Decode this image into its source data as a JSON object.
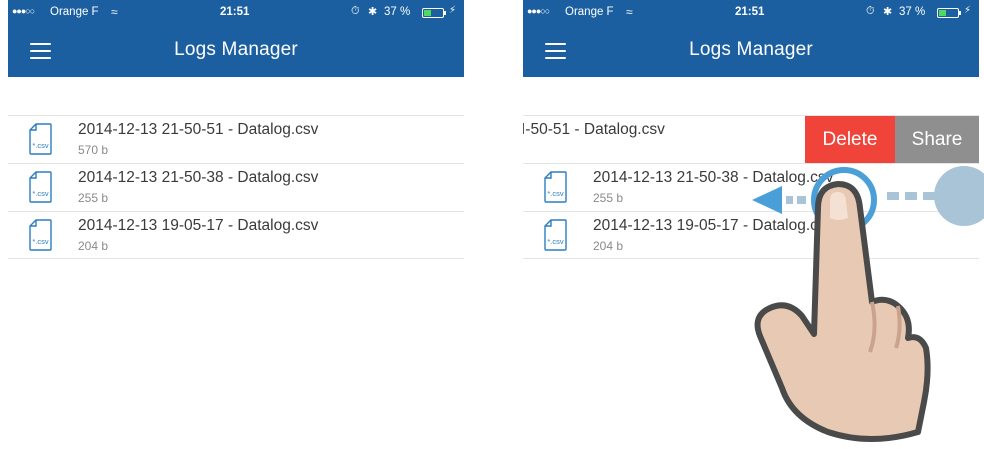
{
  "status_bar": {
    "signal": "●●●○○",
    "carrier": "Orange F",
    "time": "21:51",
    "battery": "37 %",
    "battery_level": 0.37,
    "wifi_icon": "wifi-icon",
    "alarm_icon": "alarm-clock-icon",
    "bluetooth_icon": "bluetooth-icon"
  },
  "nav": {
    "title": "Logs Manager",
    "menu_icon": "hamburger-menu-icon"
  },
  "files": [
    {
      "name": "2014-12-13 21-50-51 - Datalog.csv",
      "size": "570 b"
    },
    {
      "name": "2014-12-13 21-50-38 - Datalog.csv",
      "size": "255 b"
    },
    {
      "name": "2014-12-13 19-05-17 - Datalog.csv",
      "size": "204 b"
    }
  ],
  "file_icon_label": "*.csv",
  "swiped_row": {
    "visible_name": "I-50-51 - Datalog.csv",
    "delete_label": "Delete",
    "share_label": "Share",
    "delete_color": "#f0433a",
    "share_color": "#8f8f8f"
  },
  "colors": {
    "header": "#1b5fa0",
    "icon_blue": "#2b7dc0",
    "gesture_blue": "#4a9fd8"
  }
}
